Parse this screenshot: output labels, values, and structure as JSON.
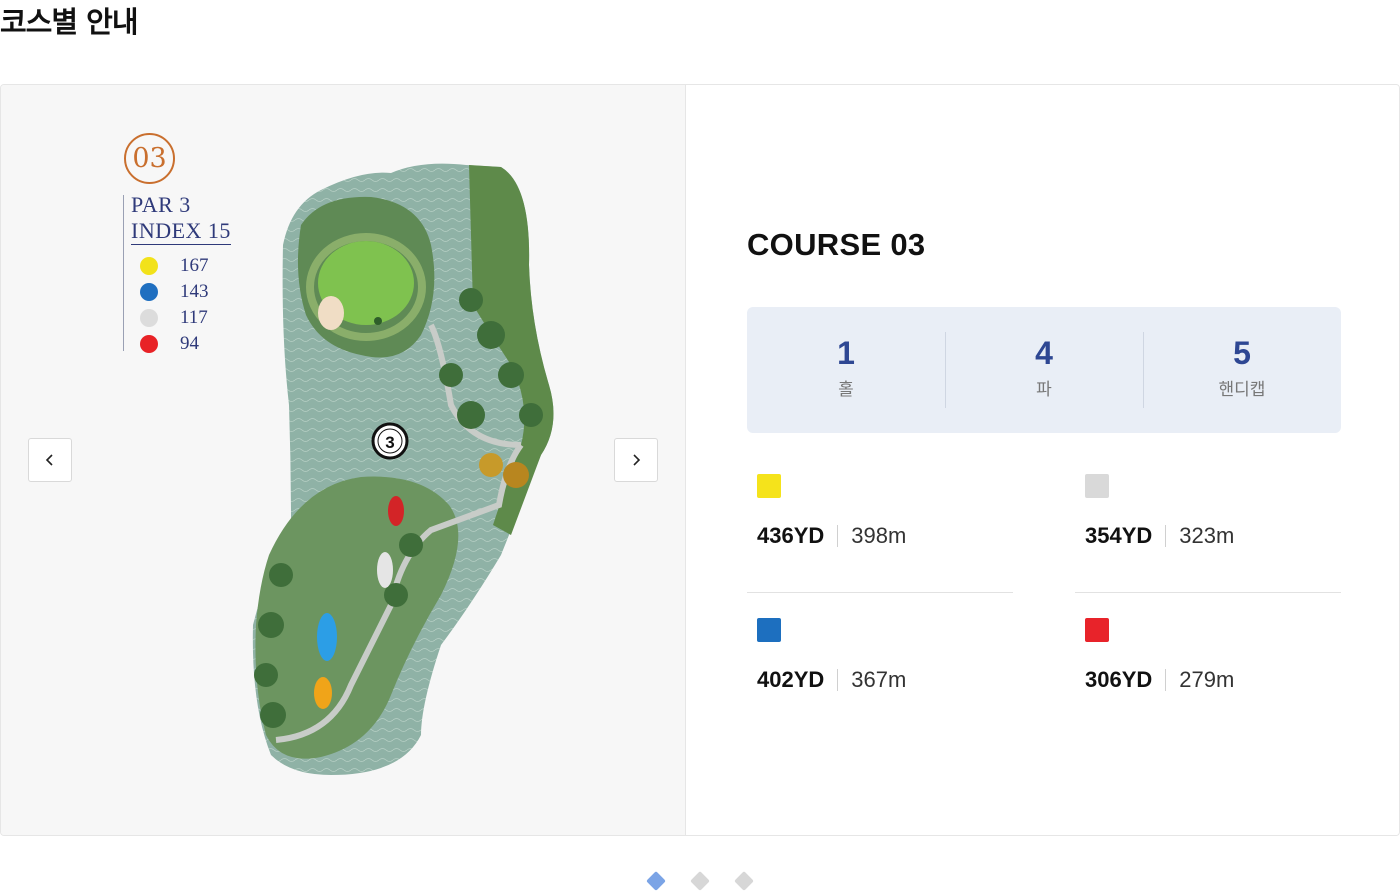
{
  "page": {
    "title": "코스별 안내"
  },
  "hole": {
    "number": "03",
    "par": "PAR 3",
    "index": "INDEX 15",
    "marker": "3",
    "legend": [
      {
        "color": "#f2e21a",
        "value": "167"
      },
      {
        "color": "#1f6fc0",
        "value": "143"
      },
      {
        "color": "#dcdcdc",
        "value": "117"
      },
      {
        "color": "#e82226",
        "value": "94"
      }
    ]
  },
  "course": {
    "title": "COURSE 03",
    "stats": [
      {
        "value": "1",
        "label": "홀"
      },
      {
        "value": "4",
        "label": "파"
      },
      {
        "value": "5",
        "label": "핸디캡"
      }
    ],
    "tees": [
      {
        "color": "#f5e31b",
        "yards": "436YD",
        "meters": "398m"
      },
      {
        "color": "#d9d9d9",
        "yards": "354YD",
        "meters": "323m"
      },
      {
        "color": "#1d6fbf",
        "yards": "402YD",
        "meters": "367m"
      },
      {
        "color": "#e8232a",
        "yards": "306YD",
        "meters": "279m"
      }
    ]
  },
  "navigation": {
    "prev_icon": "chevron-left-icon",
    "next_icon": "chevron-right-icon"
  },
  "pagination": {
    "active_color": "#7ba4e6",
    "inactive_color": "#d7d7d7",
    "pages": [
      {
        "active": true
      },
      {
        "active": false
      },
      {
        "active": false
      }
    ]
  }
}
